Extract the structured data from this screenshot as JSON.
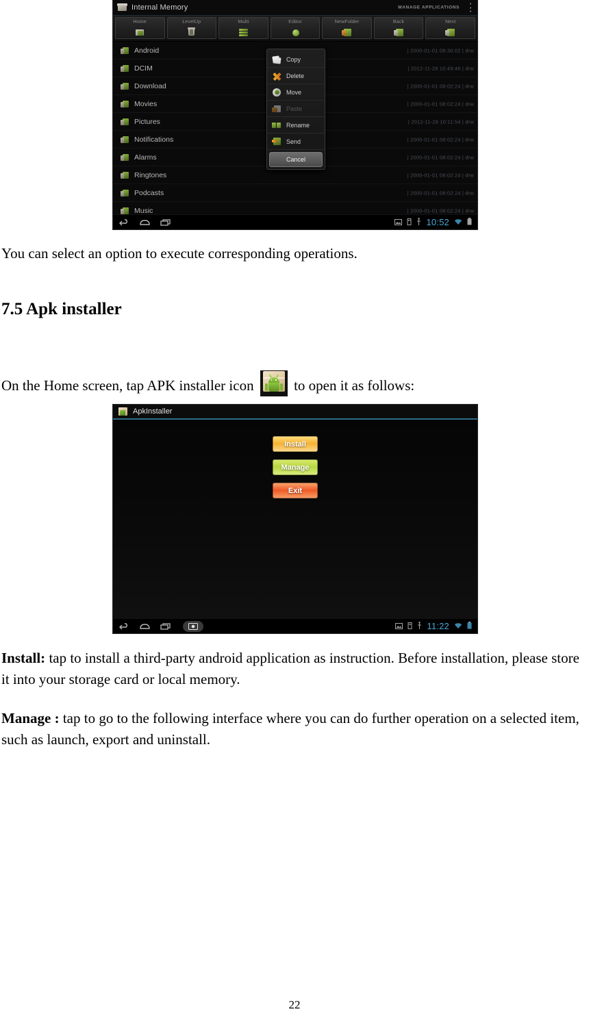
{
  "document": {
    "page_number": "22",
    "paragraph_select_option": "You can select an option to execute corresponding operations.",
    "heading_apk_installer": "7.5 Apk installer",
    "paragraph_on_home_before_icon": "On the Home screen, tap APK installer icon",
    "paragraph_on_home_after_icon": "to open it as follows:",
    "install_label": "Install:",
    "install_text": " tap to install a third-party android application as instruction. Before installation, please store it into your storage card or local memory.",
    "manage_label": "Manage :",
    "manage_text": " tap to go to the following interface where you can do further operation on a selected item, such as launch, export and uninstall.",
    "apk_inline_icon_name": "apk-installer-icon"
  },
  "file_manager_screenshot": {
    "titlebar": {
      "title": "Internal Memory",
      "title_icon": "internal-memory-icon",
      "manage_applications": "MANAGE APPLICATIONS",
      "overflow_icon": "overflow-menu-icon"
    },
    "toolbar": [
      {
        "label": "Home",
        "icon": "home-folder-icon"
      },
      {
        "label": "LevelUp",
        "icon": "level-up-icon"
      },
      {
        "label": "Multi",
        "icon": "multi-select-icon"
      },
      {
        "label": "Editor",
        "icon": "editor-icon"
      },
      {
        "label": "NewFolder",
        "icon": "new-folder-icon"
      },
      {
        "label": "Back",
        "icon": "back-folder-icon"
      },
      {
        "label": "Next",
        "icon": "next-folder-icon"
      }
    ],
    "files": [
      {
        "name": "Android",
        "meta": "| 2000-01-01 08:30:02 | drw"
      },
      {
        "name": "DCIM",
        "meta": "| 2012-11-28 10:49:46 | drw"
      },
      {
        "name": "Download",
        "meta": "| 2000-01-01 08:02:24 | drw"
      },
      {
        "name": "Movies",
        "meta": "| 2000-01-01 08:02:24 | drw"
      },
      {
        "name": "Pictures",
        "meta": "| 2012-11-28 10:11:54 | drw"
      },
      {
        "name": "Notifications",
        "meta": "| 2000-01-01 08:02:24 | drw"
      },
      {
        "name": "Alarms",
        "meta": "| 2000-01-01 08:02:24 | drw"
      },
      {
        "name": "Ringtones",
        "meta": "| 2000-01-01 08:02:24 | drw"
      },
      {
        "name": "Podcasts",
        "meta": "| 2000-01-01 08:02:24 | drw"
      },
      {
        "name": "Music",
        "meta": "| 2000-01-01 08:02:24 | drw"
      }
    ],
    "context_menu": {
      "items": [
        {
          "label": "Copy",
          "icon": "copy-icon",
          "disabled": false
        },
        {
          "label": "Delete",
          "icon": "delete-icon",
          "disabled": false
        },
        {
          "label": "Move",
          "icon": "move-icon",
          "disabled": false
        },
        {
          "label": "Paste",
          "icon": "paste-icon",
          "disabled": true
        },
        {
          "label": "Rename",
          "icon": "rename-icon",
          "disabled": false
        },
        {
          "label": "Send",
          "icon": "send-icon",
          "disabled": false
        }
      ],
      "cancel_label": "Cancel"
    },
    "system_bar": {
      "clock": "10:52",
      "nav_icons": [
        "back-icon",
        "home-icon",
        "recent-apps-icon"
      ],
      "status_icons": [
        "screenshot-icon",
        "sd-card-icon",
        "usb-icon",
        "wifi-icon",
        "battery-icon"
      ]
    }
  },
  "apk_installer_screenshot": {
    "titlebar": {
      "title": "ApkInstaller",
      "title_icon": "apk-installer-icon"
    },
    "buttons": [
      {
        "label": "Install",
        "color": "#f7b233"
      },
      {
        "label": "Manage",
        "color": "#b7d742"
      },
      {
        "label": "Exit",
        "color": "#ef5a26"
      }
    ],
    "system_bar": {
      "clock": "11:22",
      "nav_icons": [
        "back-icon",
        "home-icon",
        "recent-apps-icon",
        "screenshot-button-icon"
      ],
      "status_icons": [
        "screenshot-icon",
        "sd-card-icon",
        "usb-icon",
        "wifi-icon",
        "battery-icon"
      ]
    }
  }
}
